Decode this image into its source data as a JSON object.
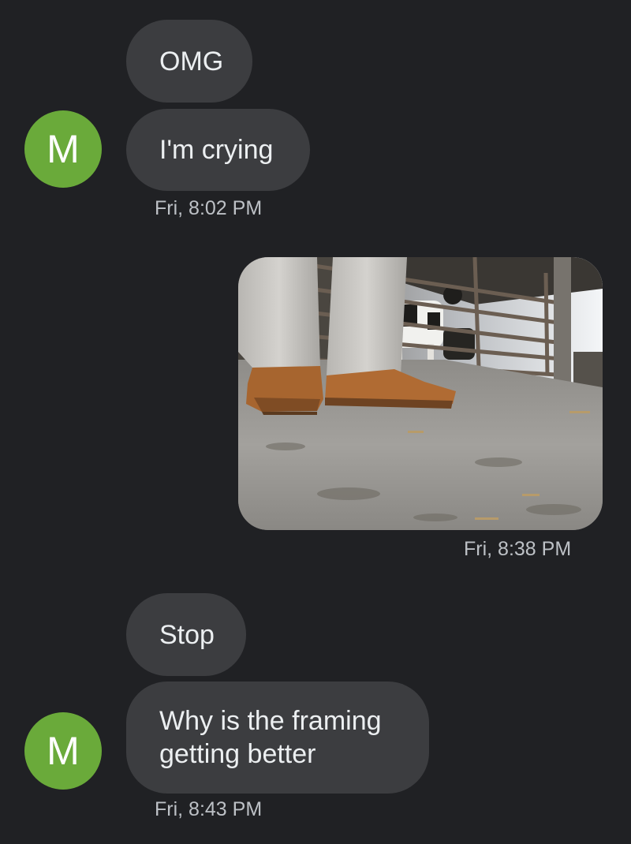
{
  "conversation": {
    "contact_initial": "M",
    "messages": [
      {
        "direction": "incoming",
        "text": "OMG"
      },
      {
        "direction": "incoming",
        "text": "I'm crying",
        "timestamp": "Fri, 8:02 PM"
      },
      {
        "direction": "outgoing",
        "type": "image",
        "image_icon": "photo-shoes-cow-pen",
        "timestamp": "Fri, 8:38 PM"
      },
      {
        "direction": "incoming",
        "text": "Stop"
      },
      {
        "direction": "incoming",
        "text": "Why is the framing getting better",
        "timestamp": "Fri, 8:43 PM"
      }
    ]
  },
  "colors": {
    "background": "#202124",
    "bubble": "#3c3d40",
    "avatar": "#6aaa3a",
    "timestamp": "#bdc1c6"
  }
}
